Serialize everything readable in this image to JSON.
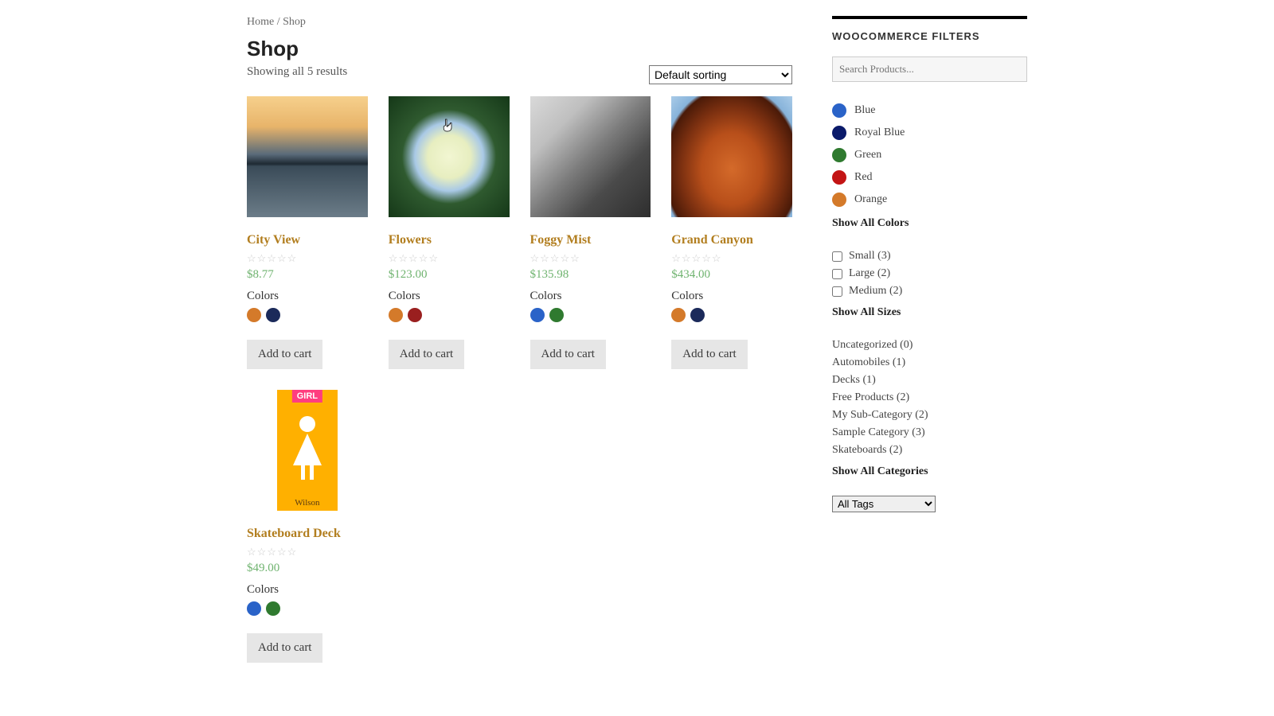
{
  "breadcrumb": {
    "home": "Home",
    "sep": "/",
    "current": "Shop"
  },
  "page": {
    "title": "Shop",
    "result_count": "Showing all 5 results"
  },
  "sort": {
    "selected": "Default sorting"
  },
  "swatch_colors": {
    "orange": "#d47a2a",
    "navy": "#1b2a5a",
    "darkred": "#9a1f1f",
    "blue": "#2a63c8",
    "green": "#2f7a2f",
    "royalblue": "#0a1a6a",
    "red": "#c31414"
  },
  "products": [
    {
      "title": "City View",
      "price": "$8.77",
      "colors_label": "Colors",
      "swatches": [
        "orange",
        "navy"
      ],
      "img_class": "img-city",
      "button": "Add to cart"
    },
    {
      "title": "Flowers",
      "price": "$123.00",
      "colors_label": "Colors",
      "swatches": [
        "orange",
        "darkred"
      ],
      "img_class": "img-flowers",
      "button": "Add to cart",
      "hover_cursor": true
    },
    {
      "title": "Foggy Mist",
      "price": "$135.98",
      "colors_label": "Colors",
      "swatches": [
        "blue",
        "green"
      ],
      "img_class": "img-foggy",
      "button": "Add to cart"
    },
    {
      "title": "Grand Canyon",
      "price": "$434.00",
      "colors_label": "Colors",
      "swatches": [
        "orange",
        "navy"
      ],
      "img_class": "img-canyon",
      "button": "Add to cart"
    },
    {
      "title": "Skateboard Deck",
      "price": "$49.00",
      "colors_label": "Colors",
      "swatches": [
        "blue",
        "green"
      ],
      "img_class": "img-skate",
      "button": "Add to cart",
      "skate": {
        "brand": "GIRL",
        "name": "Wilson"
      }
    }
  ],
  "sidebar": {
    "title": "WOOCOMMERCE FILTERS",
    "search_placeholder": "Search Products...",
    "colors": [
      {
        "label": "Blue",
        "key": "blue"
      },
      {
        "label": "Royal Blue",
        "key": "royalblue"
      },
      {
        "label": "Green",
        "key": "green"
      },
      {
        "label": "Red",
        "key": "red"
      },
      {
        "label": "Orange",
        "key": "orange"
      }
    ],
    "show_all_colors": "Show All Colors",
    "sizes": [
      {
        "label": "Small (3)"
      },
      {
        "label": "Large (2)"
      },
      {
        "label": "Medium (2)"
      }
    ],
    "show_all_sizes": "Show All Sizes",
    "categories": [
      "Uncategorized (0)",
      "Automobiles (1)",
      "Decks (1)",
      "Free Products (2)",
      "My Sub-Category (2)",
      "Sample Category (3)",
      "Skateboards (2)"
    ],
    "show_all_categories": "Show All Categories",
    "tags_selected": "All Tags"
  }
}
